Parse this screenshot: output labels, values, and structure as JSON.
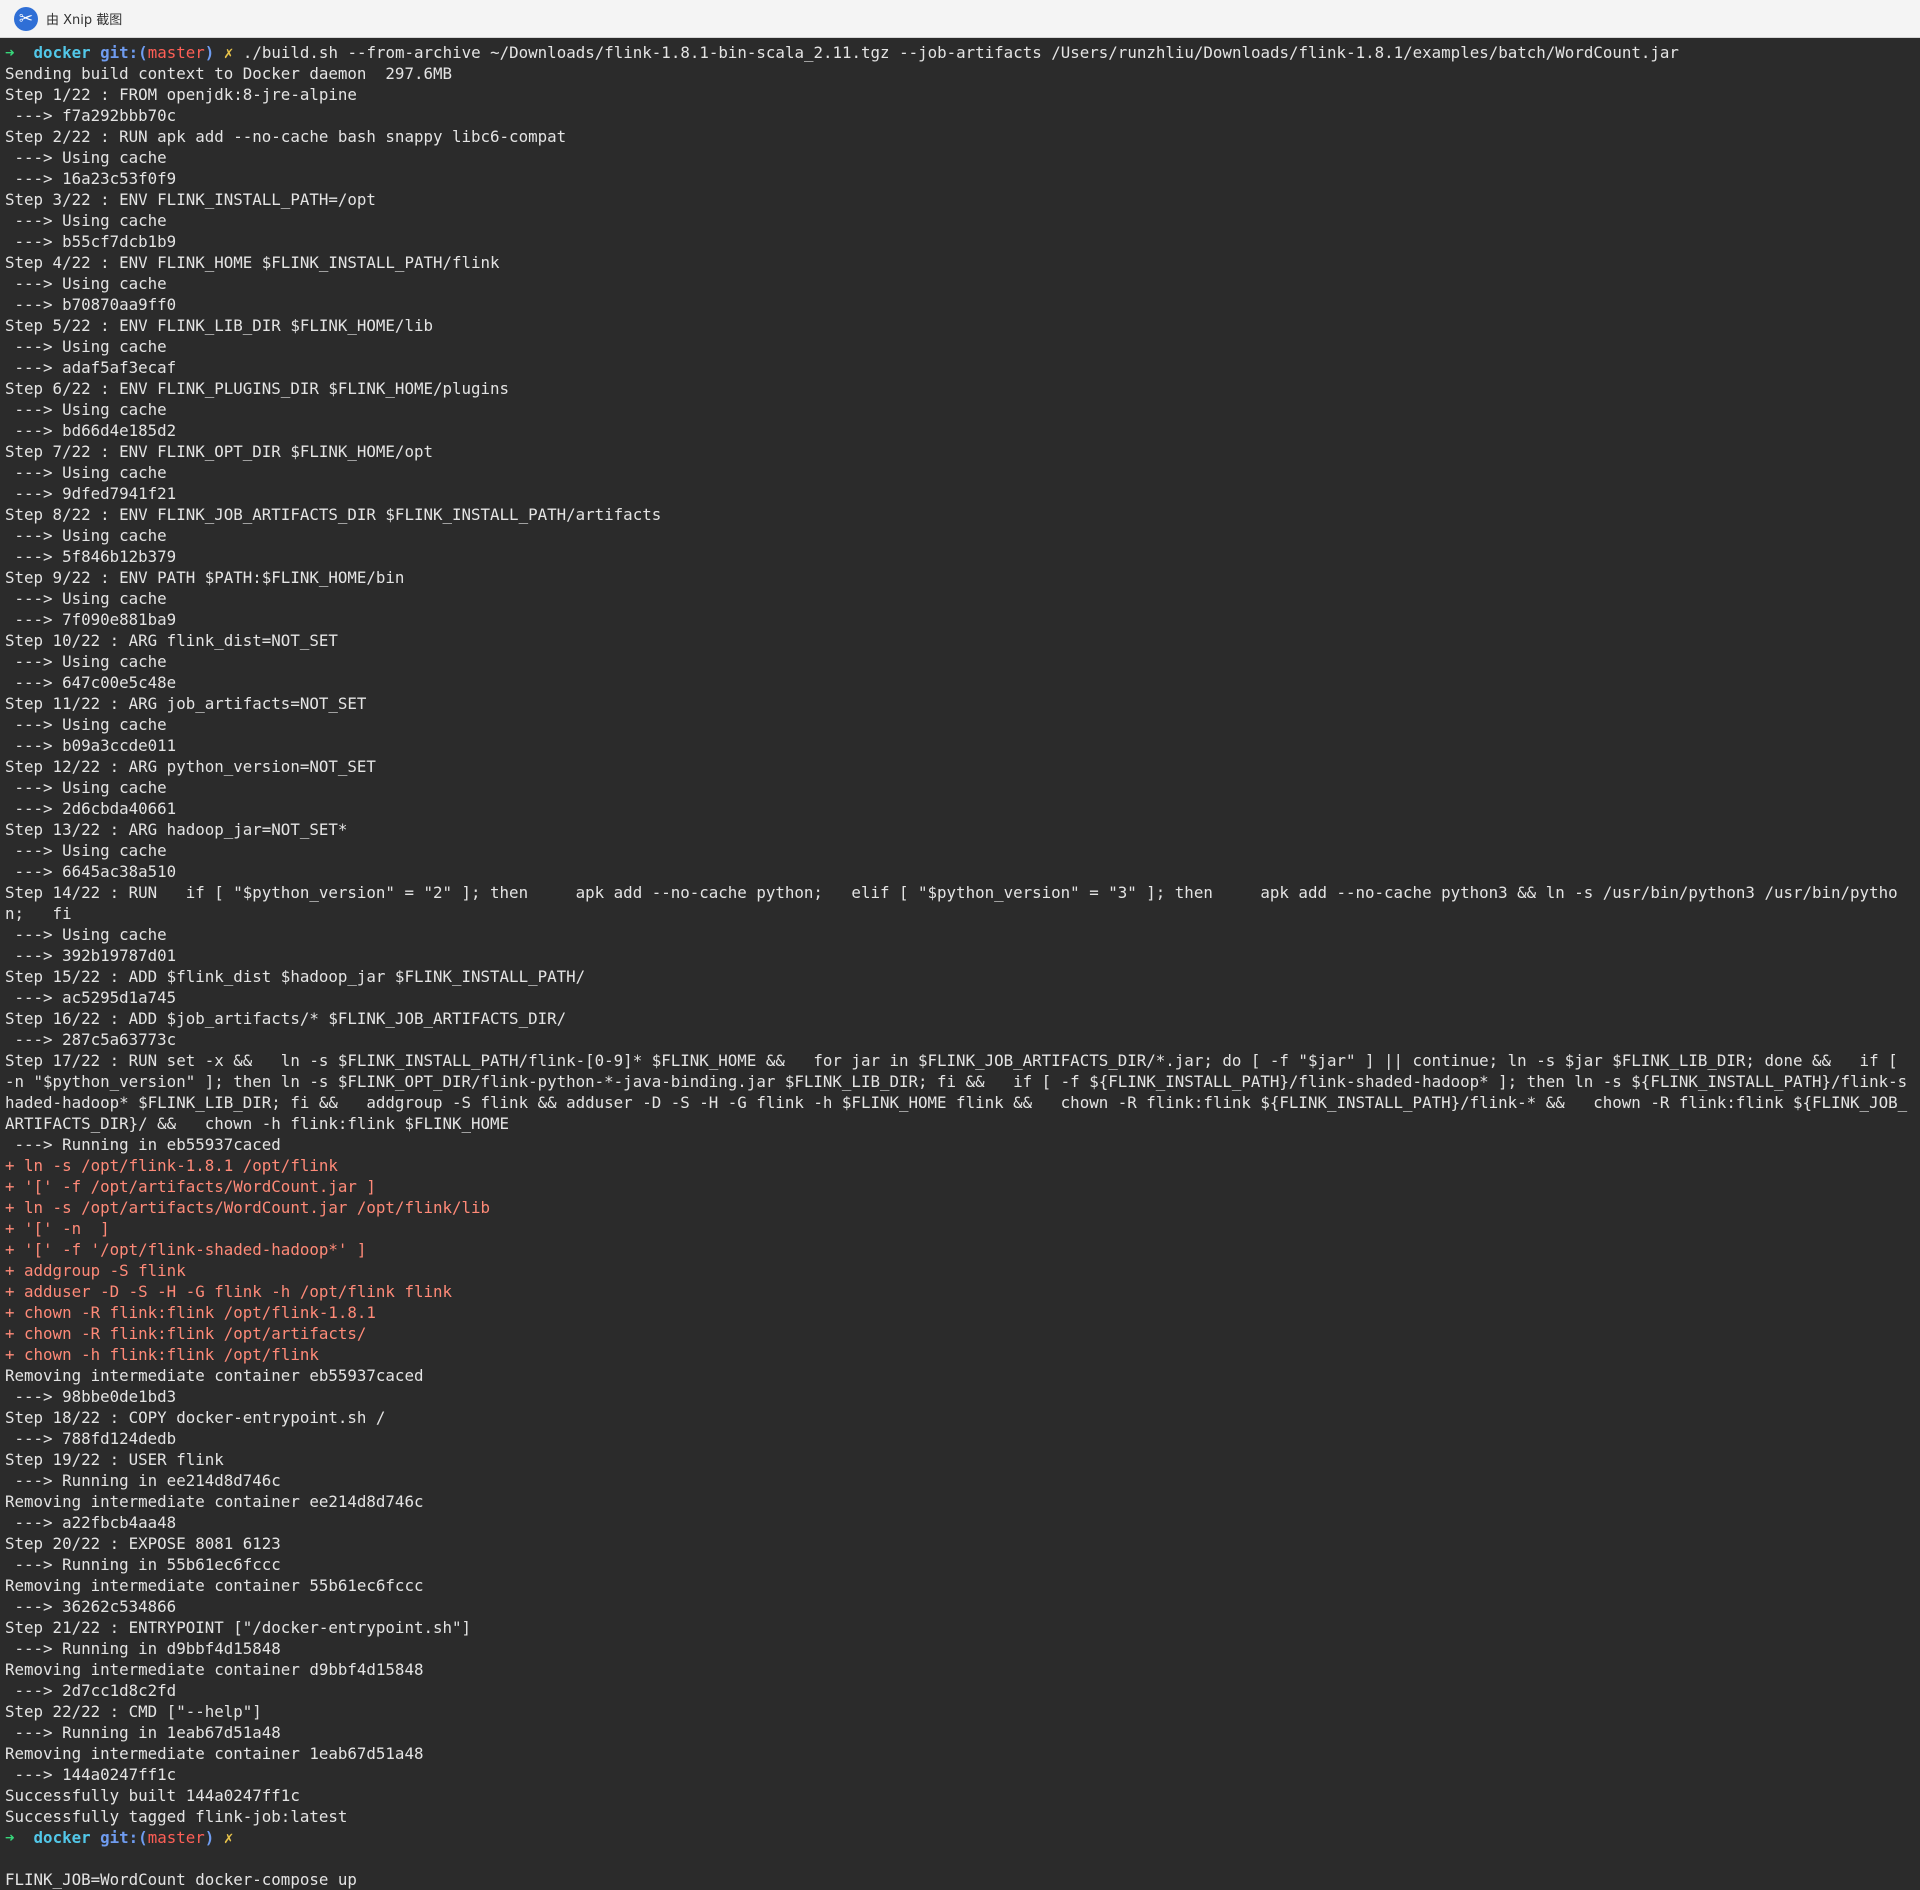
{
  "window": {
    "app_icon_glyph": "✂",
    "title": "由 Xnip 截图"
  },
  "colors": {
    "background": "#2b2b2b",
    "text": "#e4e4e4",
    "trace": "#ff8a78",
    "prompt_arrow": "#37d67a",
    "prompt_dir": "#52c7e8",
    "branch": "#ff5f56"
  },
  "prompt": {
    "arrow": "➜",
    "dir": "docker",
    "git_label": "git:(",
    "branch": "master",
    "git_close": ")",
    "dirty_mark": "✗"
  },
  "command": "./build.sh --from-archive ~/Downloads/flink-1.8.1-bin-scala_2.11.tgz --job-artifacts /Users/runzhliu/Downloads/flink-1.8.1/examples/batch/WordCount.jar",
  "lines": [
    "Sending build context to Docker daemon  297.6MB",
    "Step 1/22 : FROM openjdk:8-jre-alpine",
    " ---> f7a292bbb70c",
    "Step 2/22 : RUN apk add --no-cache bash snappy libc6-compat",
    " ---> Using cache",
    " ---> 16a23c53f0f9",
    "Step 3/22 : ENV FLINK_INSTALL_PATH=/opt",
    " ---> Using cache",
    " ---> b55cf7dcb1b9",
    "Step 4/22 : ENV FLINK_HOME $FLINK_INSTALL_PATH/flink",
    " ---> Using cache",
    " ---> b70870aa9ff0",
    "Step 5/22 : ENV FLINK_LIB_DIR $FLINK_HOME/lib",
    " ---> Using cache",
    " ---> adaf5af3ecaf",
    "Step 6/22 : ENV FLINK_PLUGINS_DIR $FLINK_HOME/plugins",
    " ---> Using cache",
    " ---> bd66d4e185d2",
    "Step 7/22 : ENV FLINK_OPT_DIR $FLINK_HOME/opt",
    " ---> Using cache",
    " ---> 9dfed7941f21",
    "Step 8/22 : ENV FLINK_JOB_ARTIFACTS_DIR $FLINK_INSTALL_PATH/artifacts",
    " ---> Using cache",
    " ---> 5f846b12b379",
    "Step 9/22 : ENV PATH $PATH:$FLINK_HOME/bin",
    " ---> Using cache",
    " ---> 7f090e881ba9",
    "Step 10/22 : ARG flink_dist=NOT_SET",
    " ---> Using cache",
    " ---> 647c00e5c48e",
    "Step 11/22 : ARG job_artifacts=NOT_SET",
    " ---> Using cache",
    " ---> b09a3ccde011",
    "Step 12/22 : ARG python_version=NOT_SET",
    " ---> Using cache",
    " ---> 2d6cbda40661",
    "Step 13/22 : ARG hadoop_jar=NOT_SET*",
    " ---> Using cache",
    " ---> 6645ac38a510",
    "Step 14/22 : RUN   if [ \"$python_version\" = \"2\" ]; then     apk add --no-cache python;   elif [ \"$python_version\" = \"3\" ]; then     apk add --no-cache python3 && ln -s /usr/bin/python3 /usr/bin/python;   fi",
    " ---> Using cache",
    " ---> 392b19787d01",
    "Step 15/22 : ADD $flink_dist $hadoop_jar $FLINK_INSTALL_PATH/",
    " ---> ac5295d1a745",
    "Step 16/22 : ADD $job_artifacts/* $FLINK_JOB_ARTIFACTS_DIR/",
    " ---> 287c5a63773c"
  ],
  "step17": "Step 17/22 : RUN set -x &&   ln -s $FLINK_INSTALL_PATH/flink-[0-9]* $FLINK_HOME &&   for jar in $FLINK_JOB_ARTIFACTS_DIR/*.jar; do [ -f \"$jar\" ] || continue; ln -s $jar $FLINK_LIB_DIR; done &&   if [ -n \"$python_version\" ]; then ln -s $FLINK_OPT_DIR/flink-python-*-java-binding.jar $FLINK_LIB_DIR; fi &&   if [ -f ${FLINK_INSTALL_PATH}/flink-shaded-hadoop* ]; then ln -s ${FLINK_INSTALL_PATH}/flink-shaded-hadoop* $FLINK_LIB_DIR; fi &&   addgroup -S flink && adduser -D -S -H -G flink -h $FLINK_HOME flink &&   chown -R flink:flink ${FLINK_INSTALL_PATH}/flink-* &&   chown -R flink:flink ${FLINK_JOB_ARTIFACTS_DIR}/ &&   chown -h flink:flink $FLINK_HOME",
  "running_17": " ---> Running in eb55937caced",
  "trace_lines": [
    "+ ln -s /opt/flink-1.8.1 /opt/flink",
    "+ '[' -f /opt/artifacts/WordCount.jar ]",
    "+ ln -s /opt/artifacts/WordCount.jar /opt/flink/lib",
    "+ '[' -n  ]",
    "+ '[' -f '/opt/flink-shaded-hadoop*' ]",
    "+ addgroup -S flink",
    "+ adduser -D -S -H -G flink -h /opt/flink flink",
    "+ chown -R flink:flink /opt/flink-1.8.1",
    "+ chown -R flink:flink /opt/artifacts/",
    "+ chown -h flink:flink /opt/flink"
  ],
  "lines_after": [
    "Removing intermediate container eb55937caced",
    " ---> 98bbe0de1bd3",
    "Step 18/22 : COPY docker-entrypoint.sh /",
    " ---> 788fd124dedb",
    "Step 19/22 : USER flink",
    " ---> Running in ee214d8d746c",
    "Removing intermediate container ee214d8d746c",
    " ---> a22fbcb4aa48",
    "Step 20/22 : EXPOSE 8081 6123",
    " ---> Running in 55b61ec6fccc",
    "Removing intermediate container 55b61ec6fccc",
    " ---> 36262c534866",
    "Step 21/22 : ENTRYPOINT [\"/docker-entrypoint.sh\"]",
    " ---> Running in d9bbf4d15848",
    "Removing intermediate container d9bbf4d15848",
    " ---> 2d7cc1d8c2fd",
    "Step 22/22 : CMD [\"--help\"]",
    " ---> Running in 1eab67d51a48",
    "Removing intermediate container 1eab67d51a48",
    " ---> 144a0247ff1c",
    "Successfully built 144a0247ff1c",
    "Successfully tagged flink-job:latest"
  ],
  "final_command": "FLINK_JOB=WordCount docker-compose up"
}
